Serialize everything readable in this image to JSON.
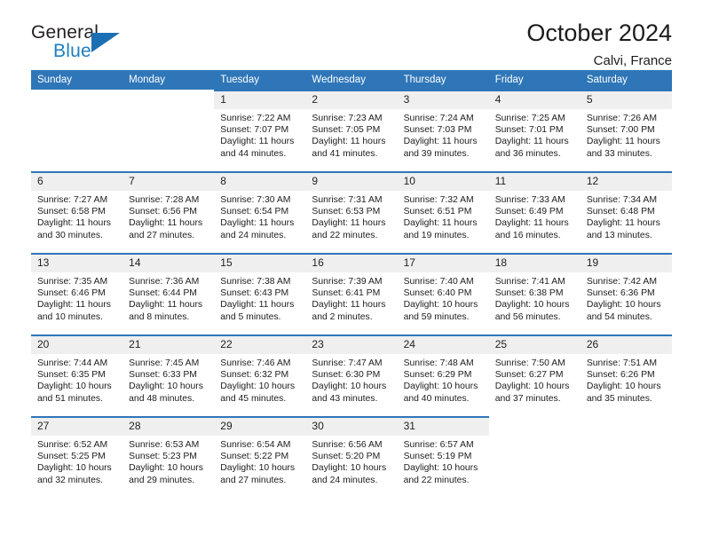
{
  "brand": {
    "name_top": "General",
    "name_bottom": "Blue",
    "triangle_icon": "triangle-icon",
    "color_dark": "#231f20",
    "color_blue": "#1a7fc1"
  },
  "header": {
    "title": "October 2024",
    "subtitle": "Calvi, France"
  },
  "theme": {
    "accent": "#2f76b8",
    "daynum_band": "#efefef",
    "text": "#1f1f1f"
  },
  "labels": {
    "sunrise_prefix": "Sunrise:",
    "sunset_prefix": "Sunset:",
    "daylight_prefix": "Daylight:"
  },
  "weekday_headers": [
    "Sunday",
    "Monday",
    "Tuesday",
    "Wednesday",
    "Thursday",
    "Friday",
    "Saturday"
  ],
  "weeks": [
    [
      {
        "day": "",
        "sunrise": "",
        "sunset": "",
        "daylight_line1": "",
        "daylight_line2": ""
      },
      {
        "day": "",
        "sunrise": "",
        "sunset": "",
        "daylight_line1": "",
        "daylight_line2": ""
      },
      {
        "day": "1",
        "sunrise": "Sunrise: 7:22 AM",
        "sunset": "Sunset: 7:07 PM",
        "daylight_line1": "Daylight: 11 hours",
        "daylight_line2": "and 44 minutes."
      },
      {
        "day": "2",
        "sunrise": "Sunrise: 7:23 AM",
        "sunset": "Sunset: 7:05 PM",
        "daylight_line1": "Daylight: 11 hours",
        "daylight_line2": "and 41 minutes."
      },
      {
        "day": "3",
        "sunrise": "Sunrise: 7:24 AM",
        "sunset": "Sunset: 7:03 PM",
        "daylight_line1": "Daylight: 11 hours",
        "daylight_line2": "and 39 minutes."
      },
      {
        "day": "4",
        "sunrise": "Sunrise: 7:25 AM",
        "sunset": "Sunset: 7:01 PM",
        "daylight_line1": "Daylight: 11 hours",
        "daylight_line2": "and 36 minutes."
      },
      {
        "day": "5",
        "sunrise": "Sunrise: 7:26 AM",
        "sunset": "Sunset: 7:00 PM",
        "daylight_line1": "Daylight: 11 hours",
        "daylight_line2": "and 33 minutes."
      }
    ],
    [
      {
        "day": "6",
        "sunrise": "Sunrise: 7:27 AM",
        "sunset": "Sunset: 6:58 PM",
        "daylight_line1": "Daylight: 11 hours",
        "daylight_line2": "and 30 minutes."
      },
      {
        "day": "7",
        "sunrise": "Sunrise: 7:28 AM",
        "sunset": "Sunset: 6:56 PM",
        "daylight_line1": "Daylight: 11 hours",
        "daylight_line2": "and 27 minutes."
      },
      {
        "day": "8",
        "sunrise": "Sunrise: 7:30 AM",
        "sunset": "Sunset: 6:54 PM",
        "daylight_line1": "Daylight: 11 hours",
        "daylight_line2": "and 24 minutes."
      },
      {
        "day": "9",
        "sunrise": "Sunrise: 7:31 AM",
        "sunset": "Sunset: 6:53 PM",
        "daylight_line1": "Daylight: 11 hours",
        "daylight_line2": "and 22 minutes."
      },
      {
        "day": "10",
        "sunrise": "Sunrise: 7:32 AM",
        "sunset": "Sunset: 6:51 PM",
        "daylight_line1": "Daylight: 11 hours",
        "daylight_line2": "and 19 minutes."
      },
      {
        "day": "11",
        "sunrise": "Sunrise: 7:33 AM",
        "sunset": "Sunset: 6:49 PM",
        "daylight_line1": "Daylight: 11 hours",
        "daylight_line2": "and 16 minutes."
      },
      {
        "day": "12",
        "sunrise": "Sunrise: 7:34 AM",
        "sunset": "Sunset: 6:48 PM",
        "daylight_line1": "Daylight: 11 hours",
        "daylight_line2": "and 13 minutes."
      }
    ],
    [
      {
        "day": "13",
        "sunrise": "Sunrise: 7:35 AM",
        "sunset": "Sunset: 6:46 PM",
        "daylight_line1": "Daylight: 11 hours",
        "daylight_line2": "and 10 minutes."
      },
      {
        "day": "14",
        "sunrise": "Sunrise: 7:36 AM",
        "sunset": "Sunset: 6:44 PM",
        "daylight_line1": "Daylight: 11 hours",
        "daylight_line2": "and 8 minutes."
      },
      {
        "day": "15",
        "sunrise": "Sunrise: 7:38 AM",
        "sunset": "Sunset: 6:43 PM",
        "daylight_line1": "Daylight: 11 hours",
        "daylight_line2": "and 5 minutes."
      },
      {
        "day": "16",
        "sunrise": "Sunrise: 7:39 AM",
        "sunset": "Sunset: 6:41 PM",
        "daylight_line1": "Daylight: 11 hours",
        "daylight_line2": "and 2 minutes."
      },
      {
        "day": "17",
        "sunrise": "Sunrise: 7:40 AM",
        "sunset": "Sunset: 6:40 PM",
        "daylight_line1": "Daylight: 10 hours",
        "daylight_line2": "and 59 minutes."
      },
      {
        "day": "18",
        "sunrise": "Sunrise: 7:41 AM",
        "sunset": "Sunset: 6:38 PM",
        "daylight_line1": "Daylight: 10 hours",
        "daylight_line2": "and 56 minutes."
      },
      {
        "day": "19",
        "sunrise": "Sunrise: 7:42 AM",
        "sunset": "Sunset: 6:36 PM",
        "daylight_line1": "Daylight: 10 hours",
        "daylight_line2": "and 54 minutes."
      }
    ],
    [
      {
        "day": "20",
        "sunrise": "Sunrise: 7:44 AM",
        "sunset": "Sunset: 6:35 PM",
        "daylight_line1": "Daylight: 10 hours",
        "daylight_line2": "and 51 minutes."
      },
      {
        "day": "21",
        "sunrise": "Sunrise: 7:45 AM",
        "sunset": "Sunset: 6:33 PM",
        "daylight_line1": "Daylight: 10 hours",
        "daylight_line2": "and 48 minutes."
      },
      {
        "day": "22",
        "sunrise": "Sunrise: 7:46 AM",
        "sunset": "Sunset: 6:32 PM",
        "daylight_line1": "Daylight: 10 hours",
        "daylight_line2": "and 45 minutes."
      },
      {
        "day": "23",
        "sunrise": "Sunrise: 7:47 AM",
        "sunset": "Sunset: 6:30 PM",
        "daylight_line1": "Daylight: 10 hours",
        "daylight_line2": "and 43 minutes."
      },
      {
        "day": "24",
        "sunrise": "Sunrise: 7:48 AM",
        "sunset": "Sunset: 6:29 PM",
        "daylight_line1": "Daylight: 10 hours",
        "daylight_line2": "and 40 minutes."
      },
      {
        "day": "25",
        "sunrise": "Sunrise: 7:50 AM",
        "sunset": "Sunset: 6:27 PM",
        "daylight_line1": "Daylight: 10 hours",
        "daylight_line2": "and 37 minutes."
      },
      {
        "day": "26",
        "sunrise": "Sunrise: 7:51 AM",
        "sunset": "Sunset: 6:26 PM",
        "daylight_line1": "Daylight: 10 hours",
        "daylight_line2": "and 35 minutes."
      }
    ],
    [
      {
        "day": "27",
        "sunrise": "Sunrise: 6:52 AM",
        "sunset": "Sunset: 5:25 PM",
        "daylight_line1": "Daylight: 10 hours",
        "daylight_line2": "and 32 minutes."
      },
      {
        "day": "28",
        "sunrise": "Sunrise: 6:53 AM",
        "sunset": "Sunset: 5:23 PM",
        "daylight_line1": "Daylight: 10 hours",
        "daylight_line2": "and 29 minutes."
      },
      {
        "day": "29",
        "sunrise": "Sunrise: 6:54 AM",
        "sunset": "Sunset: 5:22 PM",
        "daylight_line1": "Daylight: 10 hours",
        "daylight_line2": "and 27 minutes."
      },
      {
        "day": "30",
        "sunrise": "Sunrise: 6:56 AM",
        "sunset": "Sunset: 5:20 PM",
        "daylight_line1": "Daylight: 10 hours",
        "daylight_line2": "and 24 minutes."
      },
      {
        "day": "31",
        "sunrise": "Sunrise: 6:57 AM",
        "sunset": "Sunset: 5:19 PM",
        "daylight_line1": "Daylight: 10 hours",
        "daylight_line2": "and 22 minutes."
      },
      {
        "day": "",
        "sunrise": "",
        "sunset": "",
        "daylight_line1": "",
        "daylight_line2": ""
      },
      {
        "day": "",
        "sunrise": "",
        "sunset": "",
        "daylight_line1": "",
        "daylight_line2": ""
      }
    ]
  ]
}
